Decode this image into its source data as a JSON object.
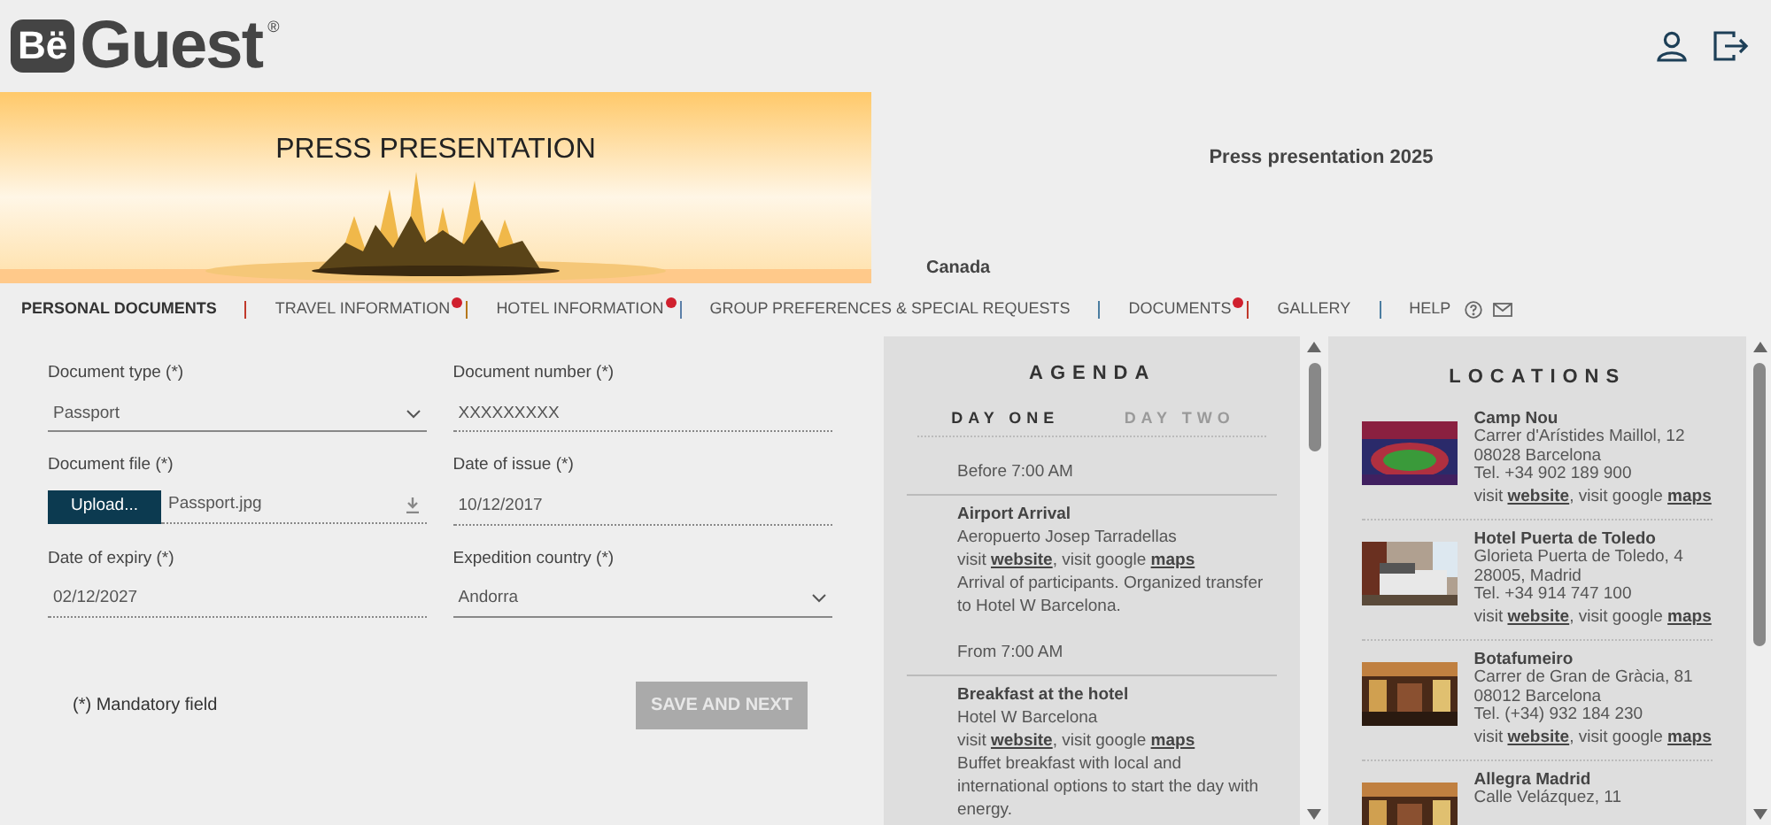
{
  "logo": {
    "badge": "Bë",
    "name": "Guest",
    "mark": "®"
  },
  "banner": {
    "title": "PRESS PRESENTATION"
  },
  "event": {
    "title": "Press presentation 2025",
    "country": "Canada"
  },
  "tabs": [
    {
      "label": "PERSONAL DOCUMENTS",
      "selected": true,
      "alert": false
    },
    {
      "label": "TRAVEL INFORMATION",
      "selected": false,
      "alert": true
    },
    {
      "label": "HOTEL INFORMATION",
      "selected": false,
      "alert": true
    },
    {
      "label": "GROUP PREFERENCES & SPECIAL REQUESTS",
      "selected": false,
      "alert": false
    },
    {
      "label": "DOCUMENTS",
      "selected": false,
      "alert": true
    },
    {
      "label": "GALLERY",
      "selected": false,
      "alert": false
    },
    {
      "label": "HELP",
      "selected": false,
      "alert": false
    }
  ],
  "form": {
    "fields": [
      {
        "kind": "select",
        "label": "Document type (*)",
        "value": "Passport"
      },
      {
        "kind": "text",
        "label": "Document number (*)",
        "value": "XXXXXXXXX"
      },
      {
        "kind": "file",
        "label": "Document file (*)",
        "button": "Upload...",
        "value": "Passport.jpg"
      },
      {
        "kind": "text",
        "label": "Date of issue (*)",
        "value": "10/12/2017"
      },
      {
        "kind": "text",
        "label": "Date of expiry (*)",
        "value": "02/12/2027"
      },
      {
        "kind": "select",
        "label": "Expedition country (*)",
        "value": "Andorra"
      }
    ],
    "note": "(*) Mandatory field",
    "submit": {
      "label": "SAVE AND NEXT",
      "disabled": true
    }
  },
  "agenda": {
    "title": "AGENDA",
    "days": [
      {
        "label": "DAY ONE",
        "selected": true
      },
      {
        "label": "DAY TWO",
        "selected": false
      }
    ],
    "items": [
      {
        "time": "Before 7:00 AM",
        "title": "Airport Arrival",
        "place": "Aeropuerto Josep Tarradellas",
        "links": [
          "visit ",
          "website",
          ", visit google ",
          "maps"
        ],
        "description": "Arrival of participants. Organized transfer to Hotel W Barcelona."
      },
      {
        "time": "From 7:00 AM",
        "title": "Breakfast at the hotel",
        "place": "Hotel W Barcelona",
        "links": [
          "visit ",
          "website",
          ", visit google ",
          "maps"
        ],
        "description": "Buffet breakfast with local and international options to start the day with energy."
      }
    ]
  },
  "locations": {
    "title": "LOCATIONS",
    "items": [
      {
        "kind": "picture",
        "name": "Camp Nou",
        "lines": [
          "Carrer d'Arístides Maillol, 12",
          "08028 Barcelona",
          "Tel. +34 902 189 900"
        ],
        "links": [
          "visit ",
          "website",
          ", visit google ",
          "maps"
        ]
      },
      {
        "kind": "picture",
        "name": "Hotel Puerta de Toledo",
        "lines": [
          "Glorieta Puerta de Toledo, 4",
          "28005, Madrid",
          "Tel. +34 914 747 100"
        ],
        "links": [
          "visit ",
          "website",
          ", visit google ",
          "maps"
        ]
      },
      {
        "kind": "picture",
        "name": "Botafumeiro",
        "lines": [
          "Carrer de Gran de Gràcia, 81",
          "08012 Barcelona",
          "Tel. (+34) 932 184 230"
        ],
        "links": [
          "visit ",
          "website",
          ", visit google ",
          "maps"
        ]
      },
      {
        "kind": "picture",
        "name": "Allegra Madrid",
        "lines": [
          "Calle Velázquez, 11"
        ]
      }
    ]
  }
}
